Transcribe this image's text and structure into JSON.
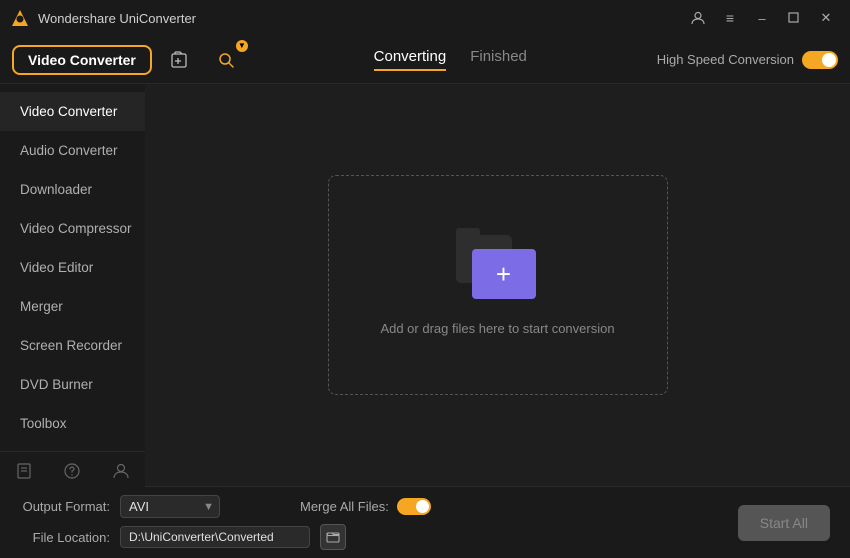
{
  "app": {
    "title": "Wondershare UniConverter",
    "icon": "🎬"
  },
  "titlebar": {
    "profile_icon": "👤",
    "menu_icon": "☰",
    "minimize_label": "–",
    "restore_label": "🗗",
    "close_label": "✕"
  },
  "toolbar": {
    "active_tool_label": "Video Converter",
    "tool_icon_1": "📄",
    "tool_icon_2": "🔍",
    "tabs": {
      "converting_label": "Converting",
      "finished_label": "Finished"
    },
    "high_speed_label": "High Speed Conversion"
  },
  "sidebar": {
    "items": [
      {
        "label": "Video Converter",
        "active": true
      },
      {
        "label": "Audio Converter",
        "active": false
      },
      {
        "label": "Downloader",
        "active": false
      },
      {
        "label": "Video Compressor",
        "active": false
      },
      {
        "label": "Video Editor",
        "active": false
      },
      {
        "label": "Merger",
        "active": false
      },
      {
        "label": "Screen Recorder",
        "active": false
      },
      {
        "label": "DVD Burner",
        "active": false
      },
      {
        "label": "Toolbox",
        "active": false
      }
    ],
    "footer": {
      "help_icon": "?",
      "book_icon": "📖",
      "user_icon": "👤"
    }
  },
  "dropzone": {
    "text": "Add or drag files here to start conversion"
  },
  "bottombar": {
    "output_format_label": "Output Format:",
    "output_format_value": "AVI",
    "merge_label": "Merge All Files:",
    "file_location_label": "File Location:",
    "file_location_value": "D:\\UniConverter\\Converted",
    "start_all_label": "Start All"
  }
}
